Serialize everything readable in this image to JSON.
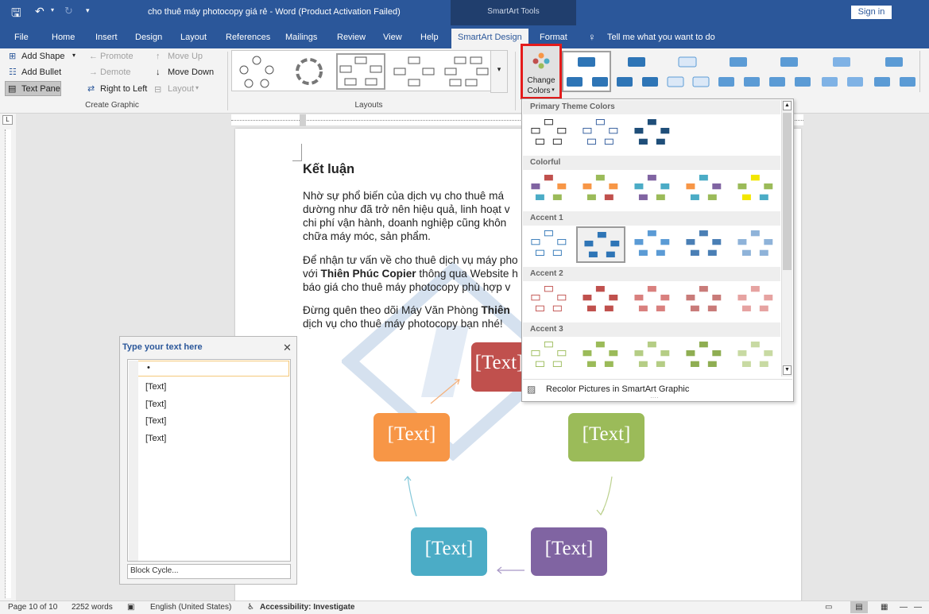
{
  "title_bar": {
    "document_title": "cho thuê máy photocopy giá rẻ  -  Word (Product Activation Failed)",
    "contextual_group": "SmartArt Tools",
    "sign_in": "Sign in"
  },
  "tabs": [
    "File",
    "Home",
    "Insert",
    "Design",
    "Layout",
    "References",
    "Mailings",
    "Review",
    "View",
    "Help",
    "SmartArt Design",
    "Format"
  ],
  "active_tab": "SmartArt Design",
  "tell_me": "Tell me what you want to do",
  "ribbon": {
    "create_graphic": {
      "add_shape": "Add Shape",
      "add_bullet": "Add Bullet",
      "text_pane": "Text Pane",
      "promote": "Promote",
      "demote": "Demote",
      "right_to_left": "Right to Left",
      "move_up": "Move Up",
      "move_down": "Move Down",
      "layout": "Layout",
      "group_label": "Create Graphic"
    },
    "layouts_label": "Layouts",
    "change_colors_line1": "Change",
    "change_colors_line2": "Colors"
  },
  "document": {
    "heading": "Kết luận",
    "p1": [
      "Nhờ sự phổ biến của dịch vụ cho thuê má",
      "dường như đã trở nên hiệu quả, linh hoạt v",
      "chi phí vận hành, doanh nghiệp cũng khôn",
      "chữa máy móc, sản phẩm."
    ],
    "p2_l1": "Để nhận tư vấn về cho thuê dịch vụ máy pho",
    "p2_l2_pre": "với ",
    "p2_l2_bold": "Thiên Phúc Copier",
    "p2_l2_post": " thông qua Website h",
    "p2_l3": "báo giá cho thuê máy photocopy phù hợp v",
    "p3_l1_pre": "Đừng quên theo dõi Máy Văn Phòng ",
    "p3_l1_bold": "Thiên",
    "p3_l2": "dịch vụ cho thuê máy photocopy bạn nhé!",
    "nodes": [
      "[Text]",
      "[Text]",
      "[Text]",
      "[Text]",
      "[Text]"
    ]
  },
  "text_pane": {
    "title": "Type your text here",
    "items": [
      "[Text]",
      "[Text]",
      "[Text]",
      "[Text]"
    ],
    "footer": "Block Cycle..."
  },
  "change_colors_menu": {
    "sections": [
      "Primary Theme Colors",
      "Colorful",
      "Accent 1",
      "Accent 2",
      "Accent 3"
    ],
    "recolor": "Recolor Pictures in SmartArt Graphic"
  },
  "status_bar": {
    "page": "Page 10 of 10",
    "words": "2252 words",
    "language": "English (United States)",
    "accessibility": "Accessibility: Investigate"
  },
  "colors": {
    "word_blue": "#2b579a",
    "node_red": "#c0504d",
    "node_orange": "#f79646",
    "node_green": "#9bbb59",
    "node_teal": "#4bacc6",
    "node_purple": "#8064a2",
    "highlight_red": "#e41b1b"
  }
}
